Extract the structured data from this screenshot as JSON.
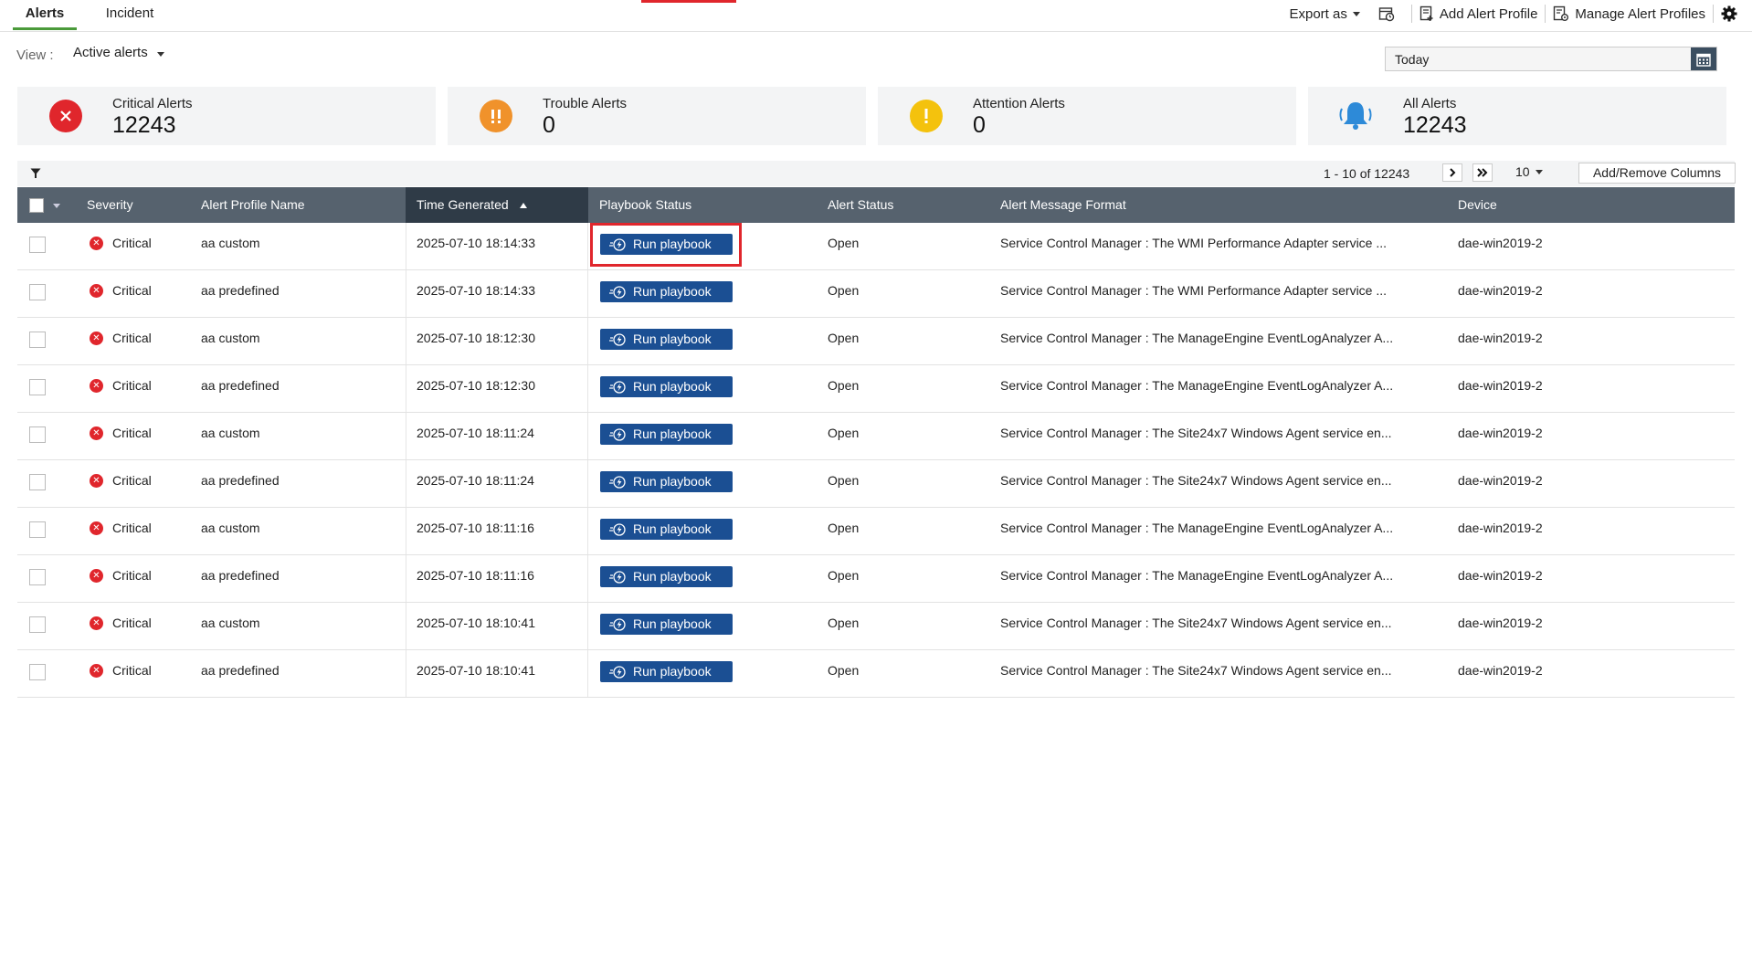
{
  "tabs": [
    {
      "label": "Alerts",
      "active": true
    },
    {
      "label": "Incident",
      "active": false
    }
  ],
  "toolbar": {
    "export_label": "Export as",
    "report_icon": "schedule-report-icon",
    "add_profile_label": "Add Alert Profile",
    "manage_profiles_label": "Manage Alert Profiles",
    "settings_icon": "gear-icon"
  },
  "view": {
    "label": "View :",
    "selected": "Active alerts"
  },
  "date_filter": {
    "value": "Today",
    "icon": "calendar-icon"
  },
  "summary": [
    {
      "label": "Critical Alerts",
      "count": "12243",
      "icon": "critical-x-icon",
      "color": "#e0262c"
    },
    {
      "label": "Trouble Alerts",
      "count": "0",
      "icon": "trouble-exclamation-icon",
      "color": "#f0922b"
    },
    {
      "label": "Attention Alerts",
      "count": "0",
      "icon": "attention-exclamation-icon",
      "color": "#f4c20d"
    },
    {
      "label": "All Alerts",
      "count": "12243",
      "icon": "bell-icon",
      "color": "#2d8ad8"
    }
  ],
  "pager": {
    "range_text": "1 - 10 of 12243",
    "page_size": "10",
    "add_remove_columns_label": "Add/Remove Columns"
  },
  "columns": {
    "severity": "Severity",
    "profile": "Alert Profile Name",
    "time": "Time Generated",
    "playbook": "Playbook Status",
    "status": "Alert Status",
    "message": "Alert Message Format",
    "device": "Device"
  },
  "rows": [
    {
      "severity": "Critical",
      "profile": "aa custom",
      "time": "2025-07-10 18:14:33",
      "playbook": "Run playbook",
      "status": "Open",
      "message": "Service Control Manager : The WMI Performance Adapter service ...",
      "device": "dae-win2019-2"
    },
    {
      "severity": "Critical",
      "profile": "aa predefined",
      "time": "2025-07-10 18:14:33",
      "playbook": "Run playbook",
      "status": "Open",
      "message": "Service Control Manager : The WMI Performance Adapter service ...",
      "device": "dae-win2019-2"
    },
    {
      "severity": "Critical",
      "profile": "aa custom",
      "time": "2025-07-10 18:12:30",
      "playbook": "Run playbook",
      "status": "Open",
      "message": "Service Control Manager : The ManageEngine EventLogAnalyzer A...",
      "device": "dae-win2019-2"
    },
    {
      "severity": "Critical",
      "profile": "aa predefined",
      "time": "2025-07-10 18:12:30",
      "playbook": "Run playbook",
      "status": "Open",
      "message": "Service Control Manager : The ManageEngine EventLogAnalyzer A...",
      "device": "dae-win2019-2"
    },
    {
      "severity": "Critical",
      "profile": "aa custom",
      "time": "2025-07-10 18:11:24",
      "playbook": "Run playbook",
      "status": "Open",
      "message": "Service Control Manager : The Site24x7 Windows Agent service en...",
      "device": "dae-win2019-2"
    },
    {
      "severity": "Critical",
      "profile": "aa predefined",
      "time": "2025-07-10 18:11:24",
      "playbook": "Run playbook",
      "status": "Open",
      "message": "Service Control Manager : The Site24x7 Windows Agent service en...",
      "device": "dae-win2019-2"
    },
    {
      "severity": "Critical",
      "profile": "aa custom",
      "time": "2025-07-10 18:11:16",
      "playbook": "Run playbook",
      "status": "Open",
      "message": "Service Control Manager : The ManageEngine EventLogAnalyzer A...",
      "device": "dae-win2019-2"
    },
    {
      "severity": "Critical",
      "profile": "aa predefined",
      "time": "2025-07-10 18:11:16",
      "playbook": "Run playbook",
      "status": "Open",
      "message": "Service Control Manager : The ManageEngine EventLogAnalyzer A...",
      "device": "dae-win2019-2"
    },
    {
      "severity": "Critical",
      "profile": "aa custom",
      "time": "2025-07-10 18:10:41",
      "playbook": "Run playbook",
      "status": "Open",
      "message": "Service Control Manager : The Site24x7 Windows Agent service en...",
      "device": "dae-win2019-2"
    },
    {
      "severity": "Critical",
      "profile": "aa predefined",
      "time": "2025-07-10 18:10:41",
      "playbook": "Run playbook",
      "status": "Open",
      "message": "Service Control Manager : The Site24x7 Windows Agent service en...",
      "device": "dae-win2019-2"
    }
  ]
}
